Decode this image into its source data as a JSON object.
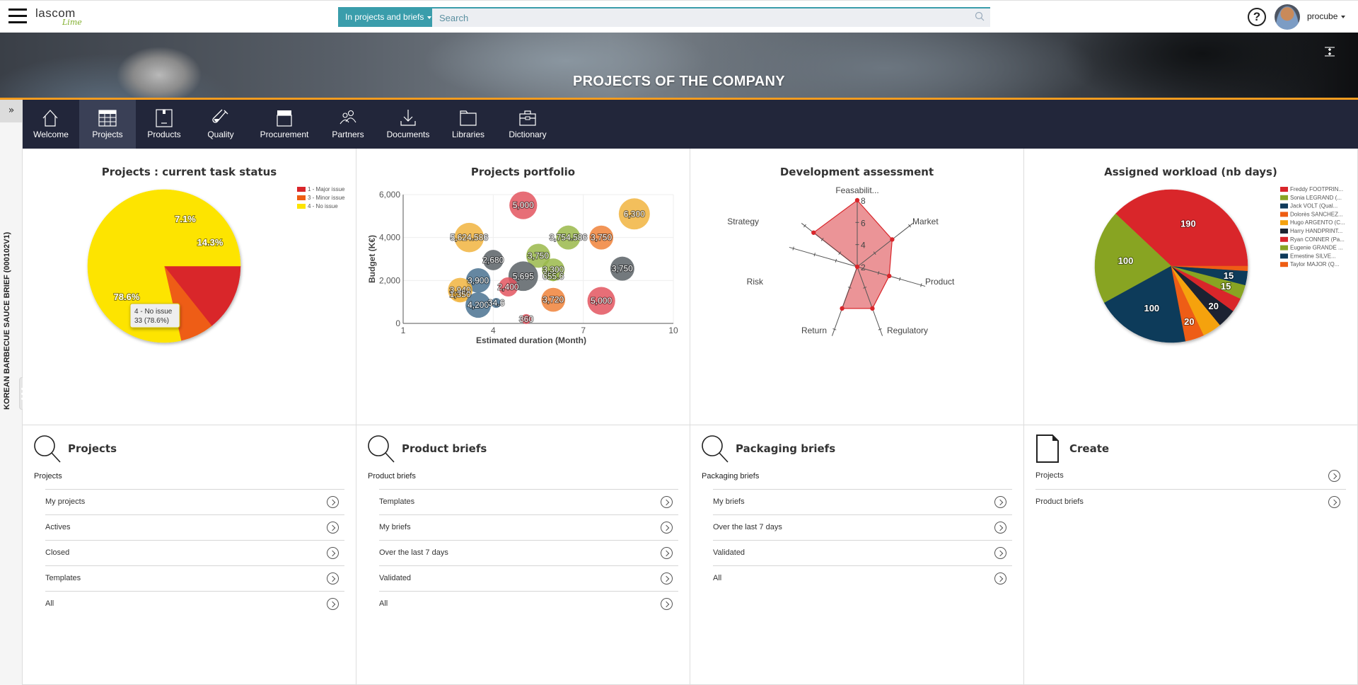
{
  "app": {
    "logo_main": "lascom",
    "logo_sub": "Lime"
  },
  "search": {
    "scope_label": "In projects and briefs",
    "placeholder": "Search",
    "value": ""
  },
  "user": {
    "name": "procube",
    "help_label": "?"
  },
  "banner": {
    "title": "PROJECTS OF THE COMPANY"
  },
  "side": {
    "expand_label": "»",
    "context_title": "KOREAN BARBECUE SAUCE BRIEF (000102V1)"
  },
  "nav": {
    "items": [
      {
        "label": "Welcome",
        "icon": "home-icon",
        "active": false
      },
      {
        "label": "Projects",
        "icon": "calendar-icon",
        "active": true
      },
      {
        "label": "Products",
        "icon": "box-icon",
        "active": false
      },
      {
        "label": "Quality",
        "icon": "test-tube-icon",
        "active": false
      },
      {
        "label": "Procurement",
        "icon": "store-icon",
        "active": false
      },
      {
        "label": "Partners",
        "icon": "people-icon",
        "active": false
      },
      {
        "label": "Documents",
        "icon": "download-icon",
        "active": false
      },
      {
        "label": "Libraries",
        "icon": "folder-icon",
        "active": false
      },
      {
        "label": "Dictionary",
        "icon": "briefcase-icon",
        "active": false
      }
    ]
  },
  "chart_data": [
    {
      "type": "pie",
      "title": "Projects : current task status",
      "legend_position": "top-right",
      "slices": [
        {
          "label": "1 - Major issue",
          "value": 6,
          "percent_label": "14.3%",
          "color": "#d9262b"
        },
        {
          "label": "3 - Minor issue",
          "value": 3,
          "percent_label": "7.1%",
          "color": "#ee5d13"
        },
        {
          "label": "4 - No issue",
          "value": 33,
          "percent_label": "78.6%",
          "color": "#fde400"
        }
      ],
      "tooltip": {
        "line1": "4 - No issue",
        "line2": "33 (78.6%)"
      }
    },
    {
      "type": "scatter",
      "title": "Projects portfolio",
      "xlabel": "Estimated duration (Month)",
      "ylabel": "Budget (K€)",
      "xlim": [
        1,
        10
      ],
      "ylim": [
        0,
        6000
      ],
      "xticks": [
        "1",
        "4",
        "7",
        "10"
      ],
      "yticks": [
        "0",
        "2,000",
        "4,000",
        "6,000"
      ],
      "grid": true,
      "points": [
        {
          "x": 5.0,
          "y": 5500,
          "size": 5000,
          "label": "5,000",
          "color": "#e3555f"
        },
        {
          "x": 8.7,
          "y": 5100,
          "size": 6300,
          "label": "6,300",
          "color": "#f1b440"
        },
        {
          "x": 3.2,
          "y": 4000,
          "size": 5624.586,
          "label": "5,624.586",
          "color": "#f1b440"
        },
        {
          "x": 6.5,
          "y": 4000,
          "size": 3754.586,
          "label": "3,754.586",
          "color": "#9ab94a"
        },
        {
          "x": 7.6,
          "y": 4000,
          "size": 3750,
          "label": "3,750",
          "color": "#f0823a"
        },
        {
          "x": 5.5,
          "y": 3150,
          "size": 3750,
          "label": "3,750",
          "color": "#9ab94a"
        },
        {
          "x": 4.0,
          "y": 2950,
          "size": 2680,
          "label": "2,680",
          "color": "#5a6266"
        },
        {
          "x": 6.0,
          "y": 2500,
          "size": 3300,
          "label": "3,300",
          "color": "#9ab94a"
        },
        {
          "x": 8.3,
          "y": 2550,
          "size": 3750,
          "label": "3,750",
          "color": "#5a6266"
        },
        {
          "x": 5.0,
          "y": 2200,
          "size": 5695,
          "label": "5,695",
          "color": "#5a6266"
        },
        {
          "x": 6.0,
          "y": 2200,
          "size": 655.6,
          "label": "655.6",
          "color": "#9ab94a"
        },
        {
          "x": 3.5,
          "y": 2000,
          "size": 3900,
          "label": "3,900",
          "color": "#4a7290"
        },
        {
          "x": 4.5,
          "y": 1700,
          "size": 2400,
          "label": "2,400",
          "color": "#e3555f"
        },
        {
          "x": 2.9,
          "y": 1550,
          "size": 3940,
          "label": "3,940",
          "color": "#f1b440"
        },
        {
          "x": 2.9,
          "y": 1350,
          "size": 1350,
          "label": "1,350",
          "color": "#f1b440"
        },
        {
          "x": 6.0,
          "y": 1100,
          "size": 3720,
          "label": "3,720",
          "color": "#f0823a"
        },
        {
          "x": 7.6,
          "y": 1050,
          "size": 5000,
          "label": "5,000",
          "color": "#e3555f"
        },
        {
          "x": 3.5,
          "y": 850,
          "size": 4200,
          "label": "4,200",
          "color": "#4a7290"
        },
        {
          "x": 4.1,
          "y": 950,
          "size": 34.6,
          "label": "34.6",
          "color": "#4a7290"
        },
        {
          "x": 5.1,
          "y": 200,
          "size": 360,
          "label": "360",
          "color": "#e3555f"
        }
      ]
    },
    {
      "type": "radar",
      "title": "Development assessment",
      "axes": [
        "Feasabilit...",
        "Market",
        "Product",
        "Regulatory",
        "Return",
        "Risk",
        "Strategy"
      ],
      "rlim": [
        2,
        8
      ],
      "rticks": [
        "2",
        "4",
        "6",
        "8"
      ],
      "values": [
        8,
        6,
        5,
        6,
        6,
        2,
        7
      ],
      "color": "#e05a5f"
    },
    {
      "type": "pie",
      "title": "Assigned workload (nb days)",
      "legend_position": "top-right",
      "slices": [
        {
          "label": "Freddy FOOTPRIN...",
          "value": 190,
          "color": "#d9262b"
        },
        {
          "label": "Sonia LEGRAND (...",
          "value": 100,
          "color": "#88a424"
        },
        {
          "label": "Jack VOLT (Qual...",
          "value": 100,
          "color": "#0e3a5a"
        },
        {
          "label": "Dolorès SANCHEZ...",
          "value": 20,
          "color": "#ee5d13"
        },
        {
          "label": "Hugo ARGENTO (C...",
          "value": 20,
          "color": "#f5a20f"
        },
        {
          "label": "Harry HANDPRINT...",
          "value": 20,
          "color": "#1e2430"
        },
        {
          "label": "Ryan CONNER (Pa...",
          "value": 15,
          "color": "#d9262b"
        },
        {
          "label": "Eugenie GRANDE ...",
          "value": 15,
          "color": "#88a424"
        },
        {
          "label": "Ernestine SILVE...",
          "value": 15,
          "color": "#0e3a5a"
        },
        {
          "label": "Taylor MAJOR (Q...",
          "value": 5,
          "color": "#ee5d13"
        }
      ],
      "data_labels": [
        "190",
        "100",
        "100",
        "20",
        "",
        "20",
        "",
        "15",
        "15",
        ""
      ]
    }
  ],
  "link_panels": [
    {
      "title": "Projects",
      "icon": "search-icon",
      "subtitle": "Projects",
      "links": [
        "My projects",
        "Actives",
        "Closed",
        "Templates",
        "All"
      ]
    },
    {
      "title": "Product briefs",
      "icon": "search-icon",
      "subtitle": "Product briefs",
      "links": [
        "Templates",
        "My briefs",
        "Over the last 7 days",
        "Validated",
        "All"
      ]
    },
    {
      "title": "Packaging briefs",
      "icon": "search-icon",
      "subtitle": "Packaging briefs",
      "links": [
        "My briefs",
        "Over the last 7 days",
        "Validated",
        "All"
      ]
    },
    {
      "title": "Create",
      "icon": "document-icon",
      "subtitle": "",
      "links": [
        "Projects",
        "Product briefs"
      ]
    }
  ]
}
